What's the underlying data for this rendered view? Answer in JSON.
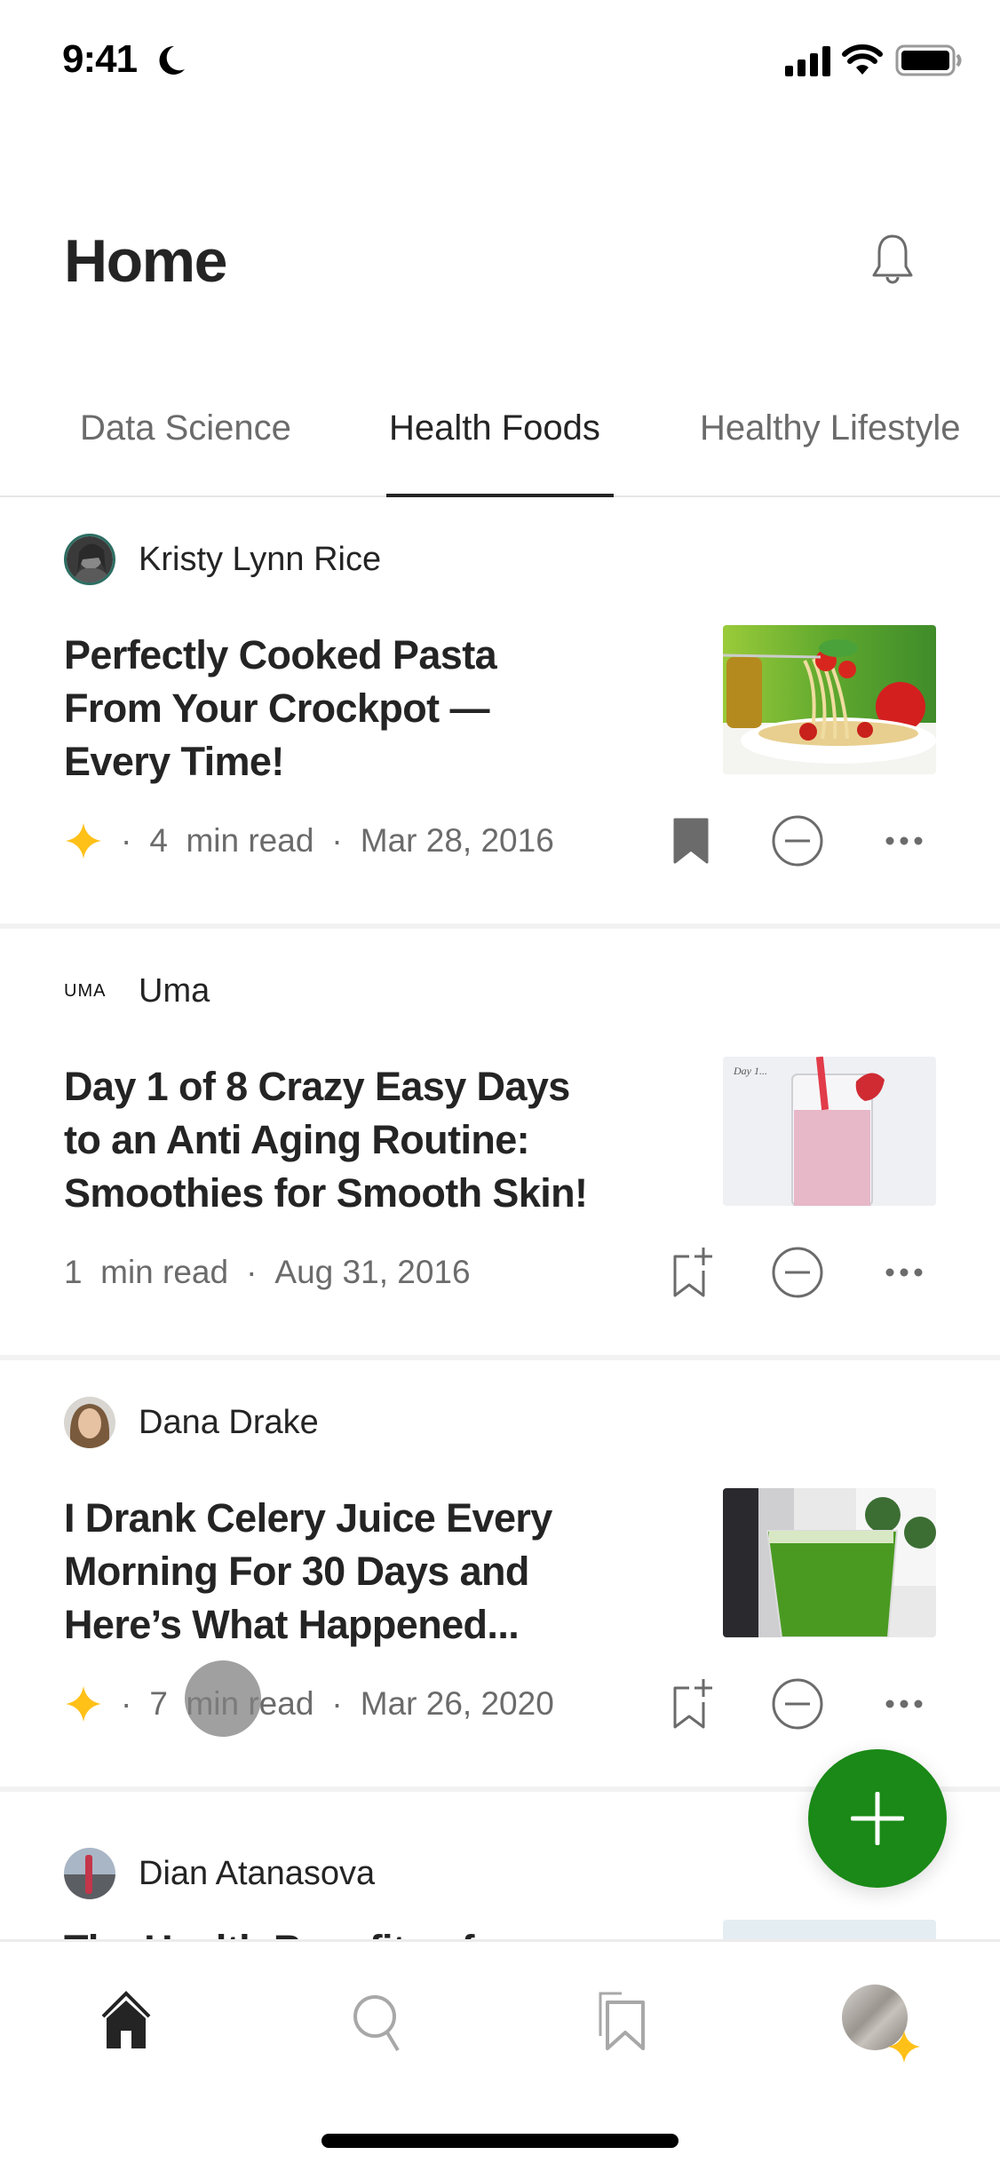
{
  "status_bar": {
    "time": "9:41",
    "icons": [
      "moon-icon",
      "cellular-signal-icon",
      "wifi-icon",
      "battery-icon"
    ]
  },
  "header": {
    "title": "Home",
    "notification_icon": "bell-icon"
  },
  "tabs": [
    {
      "label": "Data Science",
      "active": false
    },
    {
      "label": "Health Foods",
      "active": true
    },
    {
      "label": "Healthy Lifestyle",
      "active": false
    }
  ],
  "articles": [
    {
      "author": "Kristy Lynn Rice",
      "title_lines": [
        "Perfectly Cooked Pasta",
        "From Your Crockpot —",
        "Every Time!"
      ],
      "member_only": true,
      "read_time": "4  min read",
      "date": "Mar 28, 2016",
      "bookmarked": true,
      "thumbnail": "pasta-photo"
    },
    {
      "author": "Uma",
      "publication_logo": "UMA",
      "title_lines": [
        "Day 1 of 8 Crazy Easy Days",
        "to an Anti Aging Routine:",
        "Smoothies for Smooth Skin!"
      ],
      "member_only": false,
      "read_time": "1  min read",
      "date": "Aug 31, 2016",
      "bookmarked": false,
      "thumbnail": "smoothie-photo",
      "thumbnail_caption": "Day 1..."
    },
    {
      "author": "Dana Drake",
      "title_lines": [
        "I Drank Celery Juice Every",
        "Morning For 30 Days and",
        "Here’s What Happened..."
      ],
      "member_only": true,
      "read_time": "7  min read",
      "date": "Mar 26, 2020",
      "bookmarked": false,
      "thumbnail": "celery-juice-photo"
    },
    {
      "author": "Dian Atanasova",
      "title_lines": [
        "The Health Benefits of"
      ],
      "thumbnail": "partial-photo"
    }
  ],
  "separator": "·",
  "fab": {
    "icon": "plus-icon",
    "color": "#1a8917"
  },
  "bottom_nav": [
    {
      "name": "home",
      "icon": "home-icon",
      "active": true
    },
    {
      "name": "search",
      "icon": "search-icon",
      "active": false
    },
    {
      "name": "library",
      "icon": "bookmarks-icon",
      "active": false
    },
    {
      "name": "profile",
      "icon": "avatar",
      "active": false
    }
  ],
  "colors": {
    "text_primary": "#242424",
    "text_secondary": "#6b6b6b",
    "member_star": "#ffc017",
    "accent_green": "#1a8917"
  }
}
